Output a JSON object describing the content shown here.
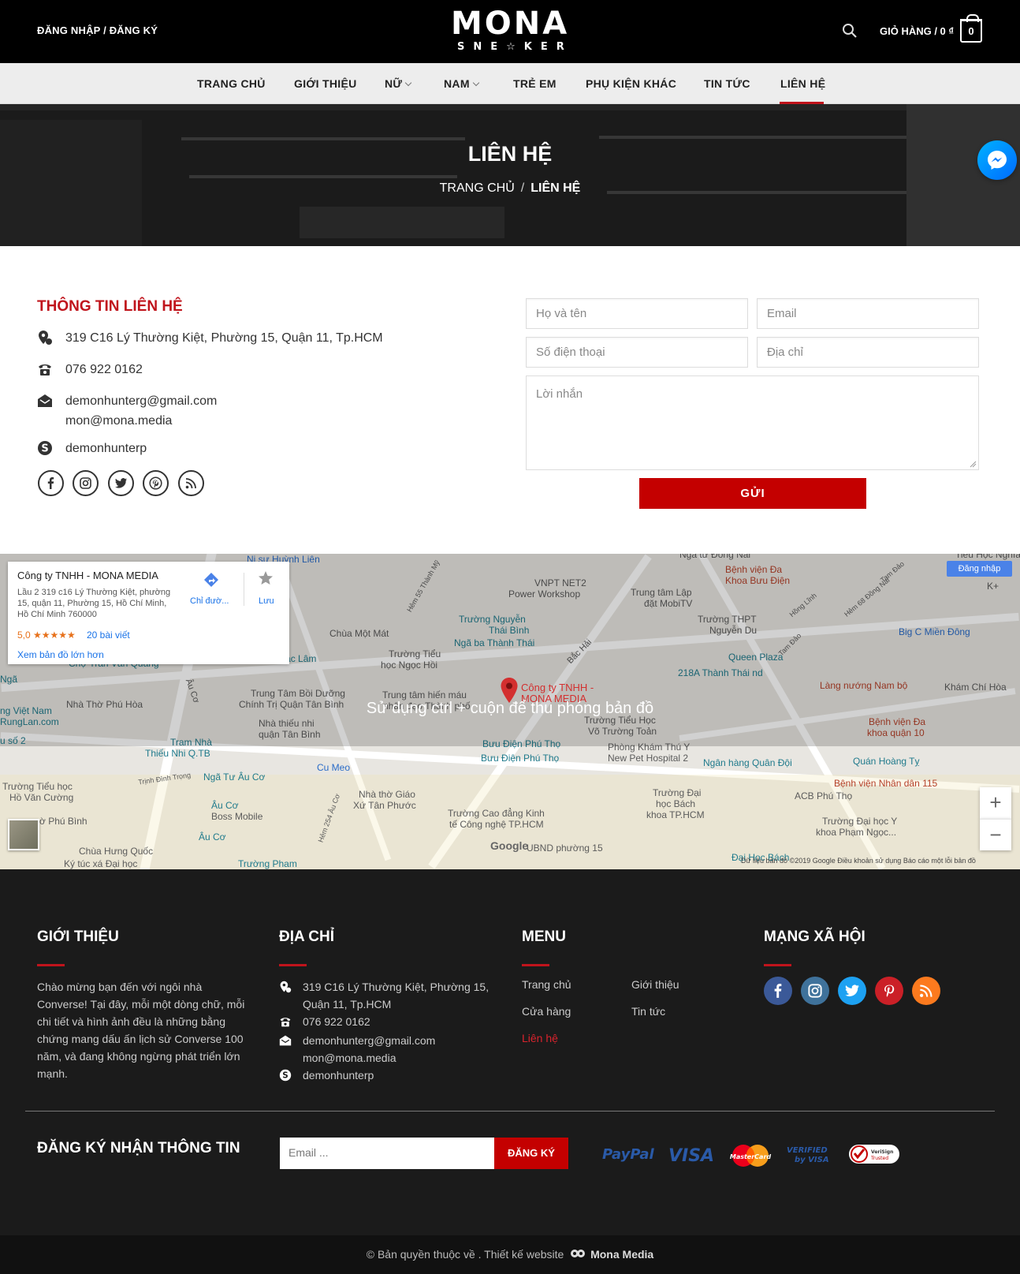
{
  "header": {
    "login_label": "ĐĂNG NHẬP / ĐĂNG KÝ",
    "logo_main": "MONA",
    "logo_sub": "SNE☆KER",
    "cart_label": "GIỎ HÀNG / 0 ₫",
    "cart_count": "0"
  },
  "nav": {
    "items": [
      {
        "label": "TRANG CHỦ"
      },
      {
        "label": "GIỚI THIỆU"
      },
      {
        "label": "NỮ"
      },
      {
        "label": "NAM"
      },
      {
        "label": "TRẺ EM"
      },
      {
        "label": "PHỤ KIỆN KHÁC"
      },
      {
        "label": "TIN TỨC"
      },
      {
        "label": "LIÊN HỆ"
      }
    ],
    "active": "LIÊN HỆ"
  },
  "hero": {
    "title": "LIÊN HỆ",
    "breadcrumb_home": "TRANG CHỦ",
    "breadcrumb_sep": "/",
    "breadcrumb_current": "LIÊN HỆ"
  },
  "contact": {
    "title": "THÔNG TIN LIÊN HỆ",
    "address": "319 C16 Lý Thường Kiệt, Phường 15, Quận 11, Tp.HCM",
    "phone": "076 922 0162",
    "email_1": "demonhunterg@gmail.com",
    "email_2": "mon@mona.media",
    "skype": "demonhunterp"
  },
  "form": {
    "name_placeholder": "Họ và tên",
    "email_placeholder": "Email",
    "phone_placeholder": "Số điện thoại",
    "address_placeholder": "Địa chỉ",
    "message_placeholder": "Lời nhắn",
    "submit_label": "GỬI"
  },
  "map": {
    "card_name": "Công ty TNHH - MONA MEDIA",
    "card_address": "Lầu 2 319 c16 Lý Thường Kiệt, phường 15, quận 11, Phường 15, Hồ Chí Minh, Hồ Chí Minh 760000",
    "card_rating": "5,0 ★★★★★",
    "card_reviews": "20 bài viết",
    "card_big_map": "Xem bản đồ lớn hơn",
    "card_directions": "Chỉ đườ...",
    "card_save": "Lưu",
    "signin": "Đăng nhập",
    "hint": "Sử dụng ctrl + cuộn để thu phóng bản đồ",
    "pin_label_1": "Công ty TNHH -",
    "pin_label_2": "MONA MEDIA",
    "zoom_in": "+",
    "zoom_out": "−",
    "google": "Google",
    "footer_text": "Dữ liệu bản đồ ©2019 Google    Điều khoản sử dụng    Báo cáo một lỗi bản đồ",
    "labels": [
      "Ni sư Huỳnh Liên",
      "VNPT NET2",
      "Power Workshop",
      "Trung tâm Lập",
      "đặt MobiTV",
      "Bệnh viện Đa",
      "Khoa Bưu Điện",
      "Big C Miền Đông",
      "Trường Nguyễn",
      "Thái Bình",
      "Ngã ba Thành Thái",
      "Chùa Một Mát",
      "Trường THPT",
      "Nguyễn Du",
      "Queen Plaza",
      "218A Thành Thái nd",
      "Chợ Trần Văn Quang",
      "Chùa Giác Lâm",
      "Trường Tiểu",
      "học Ngọc Hồi",
      "Làng nướng Nam bộ",
      "Khám Chí Hòa",
      "Nhà Thờ Phú Hòa",
      "Trung Tâm Bồi Dưỡng",
      "Chính Trị Quận Tân Bình",
      "Trung tâm hiến máu",
      "nhân đạo Thành phố",
      "Trường Tiểu Học",
      "Võ Trường Toản",
      "Bệnh viện Đa",
      "khoa quận 10",
      "Ngã",
      "ng Việt Nam",
      "RungLan.com",
      "u số 2",
      "Nhà thiếu nhi",
      "quận Tân Bình",
      "Tram Nhà",
      "Thiếu Nhi Q.TB",
      "Bưu Điện Phú Thọ",
      "Bưu Điện Phú Thọ",
      "Phòng Khám Thú Y",
      "New Pet Hospital 2",
      "Ngân hàng Quân Đội",
      "Quán Hoàng Tỵ",
      "Bệnh viện Nhân dân 115",
      "Cu Meo",
      "Trường Tiểu học",
      "Hồ Văn Cường",
      "Ngã Tư Âu Cơ",
      "Nhà thờ Giáo",
      "Xứ Tân Phước",
      "Trường Đại",
      "học Bách",
      "khoa TP.HCM",
      "ACB Phú Thọ",
      "ờ Phú Bình",
      "Âu Cơ",
      "Boss Mobile",
      "Trường Cao đẳng Kinh",
      "tế Công nghệ TP.HCM",
      "Trường Đại học Y",
      "khoa Phạm Ngọc...",
      "Âu Cơ",
      "Chùa Hưng Quốc",
      "Ký túc xá Đại học",
      "Trường Pham",
      "UBND phường 15",
      "Đại Học Bách",
      "Trịnh Đình Trọng",
      "Hẻm 254 Âu Cơ",
      "Bắc Hải",
      "Âu Cơ",
      "Tam Đảo",
      "Hẻm 55 Thành Mỹ",
      "Hồng Lĩnh",
      "Hẻm 68 Đồng Nai",
      "Tam Đảo",
      "K+",
      "Ngã tư Đồng Nai",
      "Tiểu Học Nghĩa Thu"
    ]
  },
  "footer": {
    "about_title": "GIỚI THIỆU",
    "about_text": "Chào mừng bạn đến với ngôi nhà Converse! Tại đây, mỗi một dòng chữ, mỗi chi tiết và hình ảnh đều là những bằng chứng mang dấu ấn lịch sử Converse 100 năm, và đang không ngừng phát triển lớn mạnh.",
    "address_title": "ĐỊA CHỈ",
    "address_line_1": "319 C16 Lý Thường Kiệt, Phường 15,",
    "address_line_2": "Quận 11, Tp.HCM",
    "phone": "076 922 0162",
    "email_1": "demonhunterg@gmail.com",
    "email_2": "mon@mona.media",
    "skype": "demonhunterp",
    "menu_title": "MENU",
    "menu": {
      "home": "Trang chủ",
      "about": "Giới thiệu",
      "shop": "Cửa hàng",
      "news": "Tin tức",
      "contact": "Liên hệ"
    },
    "social_title": "MẠNG XÃ HỘI",
    "social_colors": {
      "facebook": "#3b5998",
      "instagram": "#3f729b",
      "twitter": "#1da1f2",
      "pinterest": "#cb2027",
      "rss": "#fc7a1e"
    },
    "newsletter_title": "ĐĂNG KÝ NHẬN THÔNG TIN",
    "newsletter_placeholder": "Email ...",
    "subscribe_label": "ĐĂNG KÝ",
    "payments": {
      "paypal": "PayPal",
      "visa": "VISA",
      "mastercard": "MasterCard",
      "verified_1": "VERIFIED",
      "verified_2": "by VISA",
      "verisign_1": "VeriSign",
      "verisign_2": "Trusted"
    }
  },
  "copyright": {
    "text": "© Bản quyền thuộc về . Thiết kế website",
    "brand": "Mona Media"
  },
  "colors": {
    "accent": "#c0141c",
    "button": "#c40000",
    "header_bg": "#000000",
    "footer_bg": "#1b1b1b"
  }
}
